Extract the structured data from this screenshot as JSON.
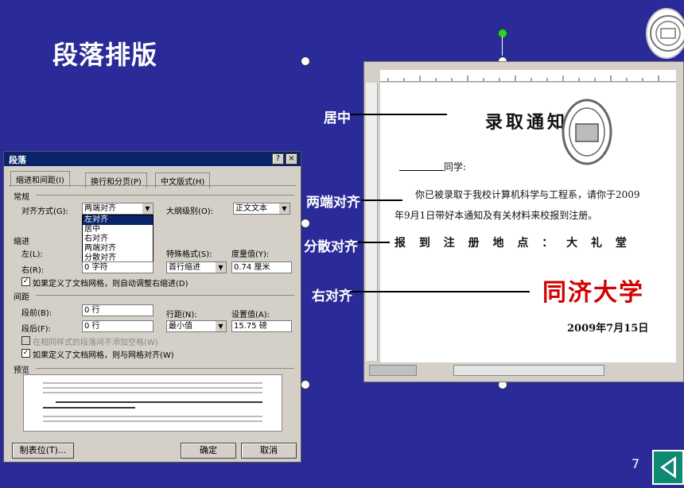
{
  "slide": {
    "title": "段落排版",
    "page_number": "7"
  },
  "document": {
    "heading": "录取通知",
    "greeting": "同学:",
    "body_line1": "你已被录取于我校计算机科学与工程系，请你于2009",
    "body_line2": "年9月1日带好本通知及有关材料来校报到注册。",
    "report_line": "报 到 注 册 地 点 ： 大 礼 堂",
    "signature": "同济大学",
    "date": "2009年7月15日"
  },
  "annotations": {
    "center": "居中",
    "justify": "两端对齐",
    "distributed": "分散对齐",
    "right": "右对齐"
  },
  "dialog": {
    "title": "段落",
    "help": "?",
    "close": "×",
    "tabs": [
      "缩进和间距(I)",
      "换行和分页(P)",
      "中文版式(H)"
    ],
    "general_label": "常规",
    "alignment_label": "对齐方式(G):",
    "alignment_value": "两端对齐",
    "alignment_options": [
      "左对齐",
      "居中",
      "右对齐",
      "两端对齐",
      "分散对齐"
    ],
    "outline_label": "大纲级别(O):",
    "outline_value": "正文文本",
    "indent_label": "缩进",
    "left_label": "左(L):",
    "right_label": "右(R):",
    "right_value": "0 字符",
    "special_label": "特殊格式(S):",
    "special_value": "首行缩进",
    "measure_label": "度量值(Y):",
    "measure_value": "0.74 厘米",
    "auto_indent_check": "如果定义了文档网格，则自动调整右缩进(D)",
    "spacing_label": "间距",
    "before_label": "段前(B):",
    "before_value": "0 行",
    "after_label": "段后(F):",
    "after_value": "0 行",
    "line_spacing_label": "行距(N):",
    "line_spacing_value": "最小值",
    "setting_label": "设置值(A):",
    "setting_value": "15.75 磅",
    "no_space_check": "在相同样式的段落间不添加空格(W)",
    "grid_check": "如果定义了文档网格，则与网格对齐(W)",
    "preview_label": "预览",
    "tabs_button": "制表位(T)...",
    "ok_button": "确定",
    "cancel_button": "取消"
  },
  "colors": {
    "slide_bg": "#2a2a98",
    "title_bar": "#0a246a",
    "signature_red": "#d40000",
    "nav_green": "#0e8a72"
  },
  "icons": [
    "rotate-handle-icon",
    "resize-handle-icon",
    "back-arrow-icon",
    "university-seal-icon"
  ]
}
